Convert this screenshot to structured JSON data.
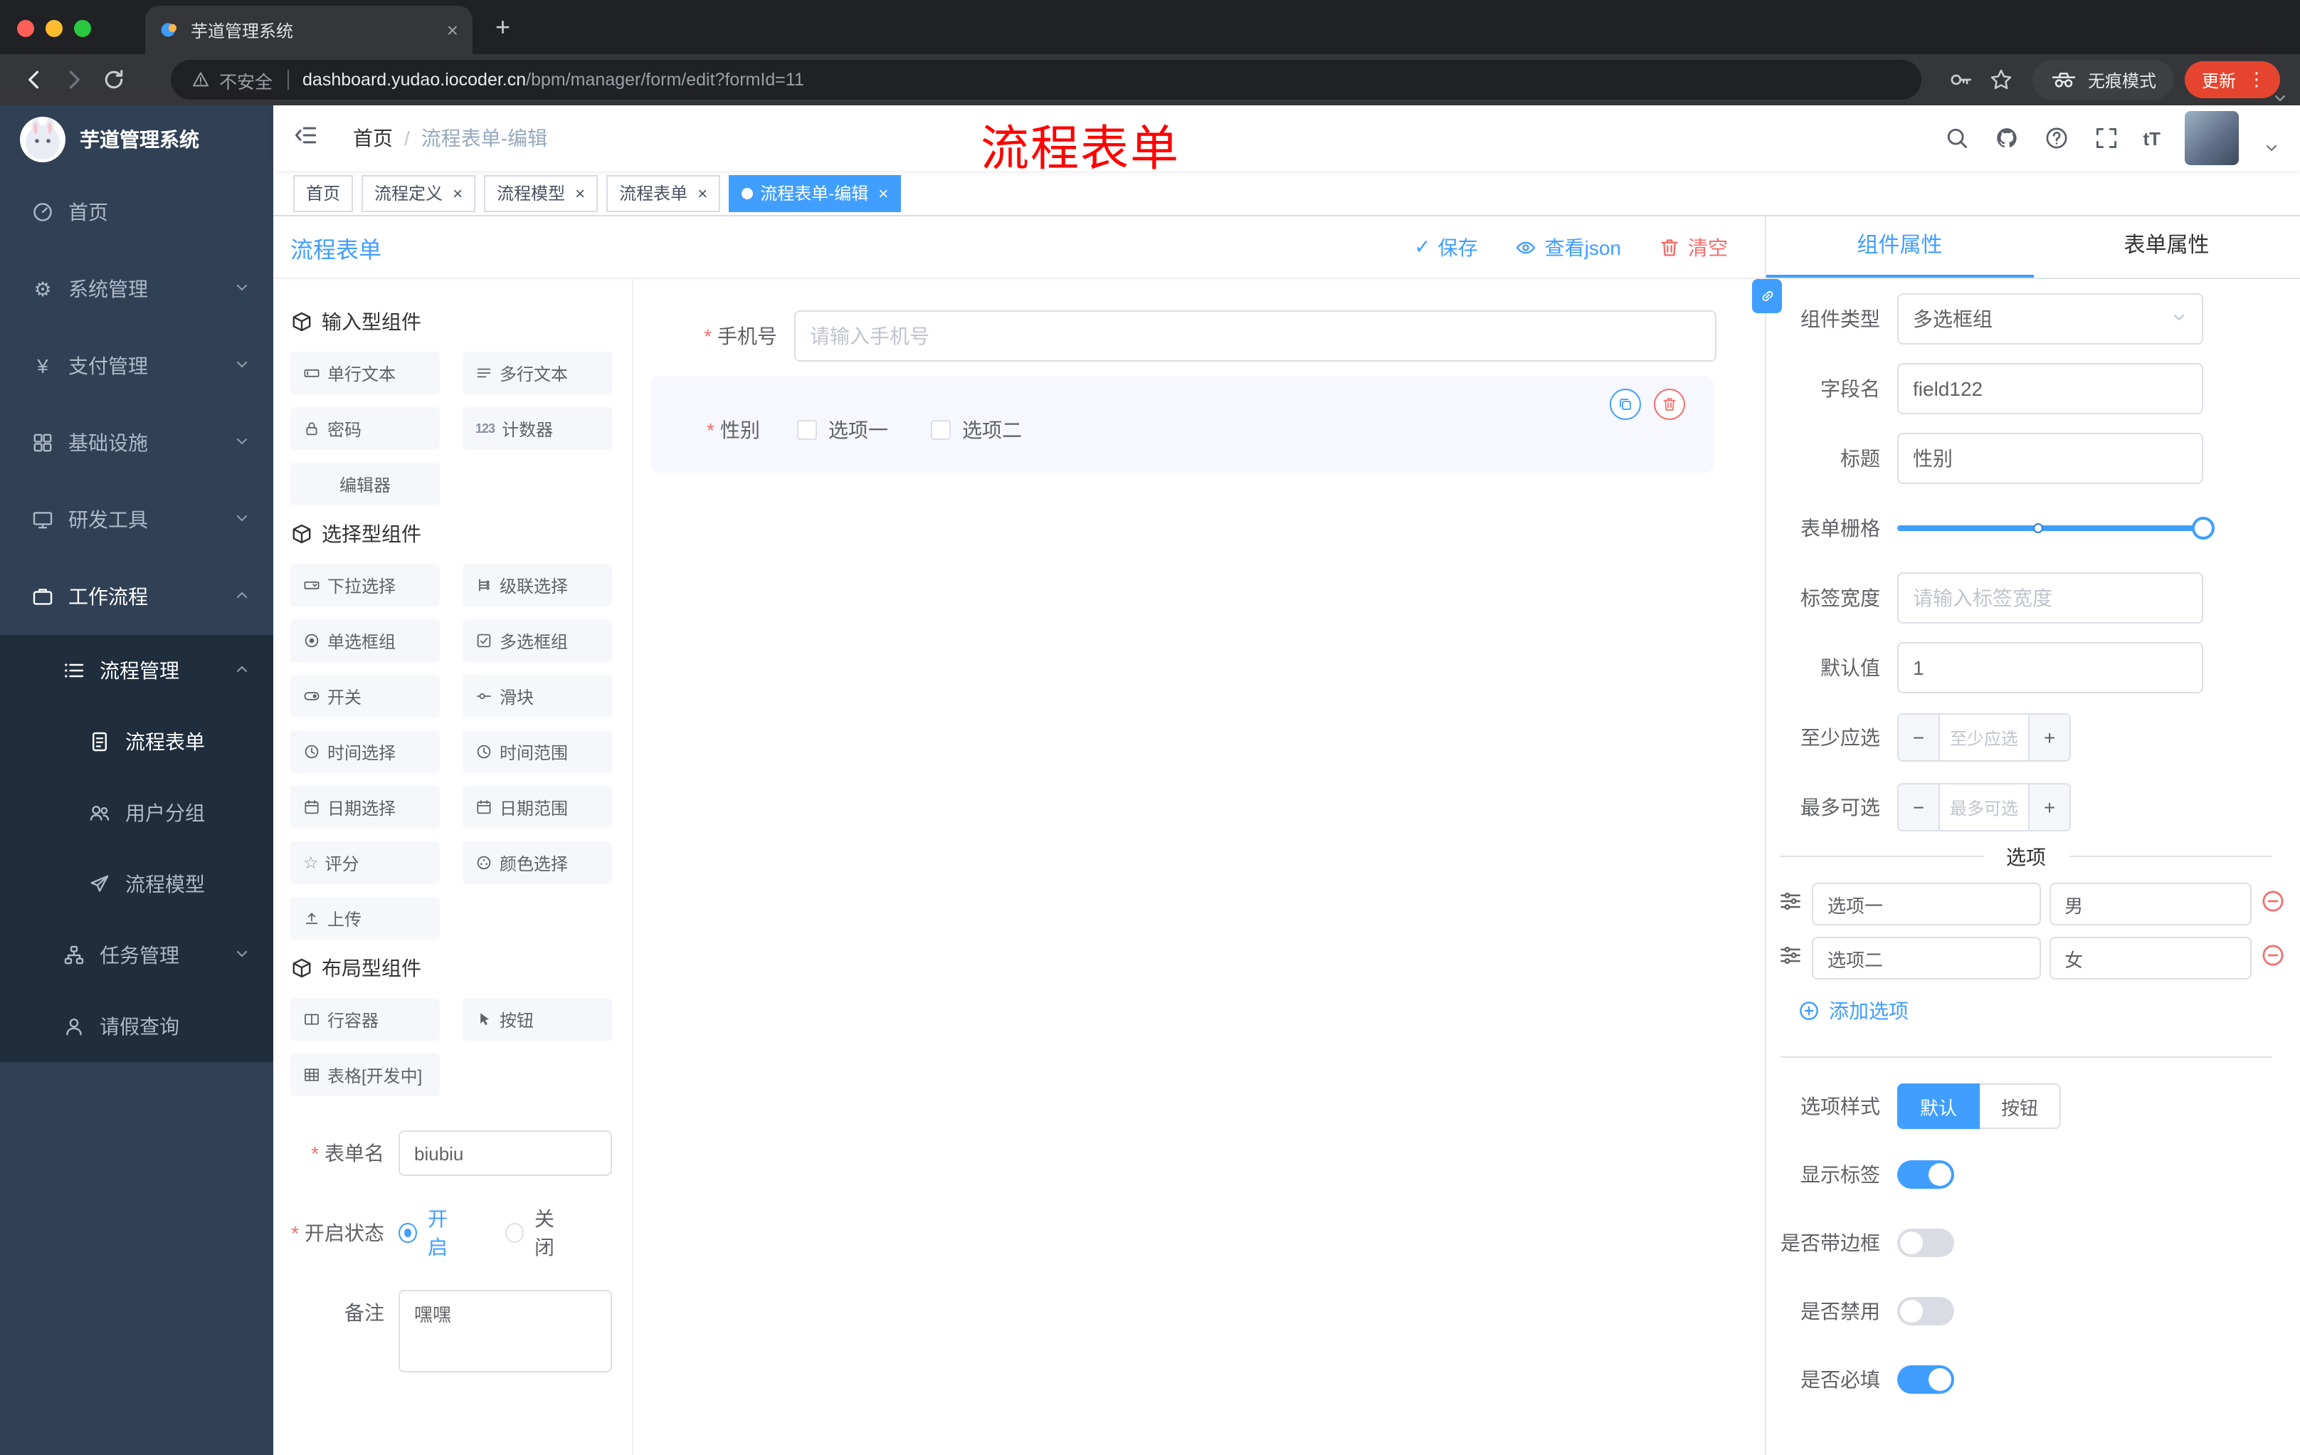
{
  "colors": {
    "primary": "#409eff",
    "danger": "#f56c6c",
    "update_chip": "#e5452f",
    "sidebar_bg": "#304156",
    "submenu_bg": "#1f2d3d",
    "annotation_red": "#fe0000"
  },
  "icons": {
    "close": "×",
    "plus": "+",
    "kebab": "⋮",
    "check": "✓",
    "gear": "⚙",
    "yen": "¥",
    "star": "☆",
    "question": "?",
    "text_size": "tT",
    "counter": "123"
  },
  "browser": {
    "tab_title": "芋道管理系统",
    "security_label": "不安全",
    "url_domain": "dashboard.yudao.iocoder.cn",
    "url_path": "/bpm/manager/form/edit?formId=11",
    "incognito_label": "无痕模式",
    "update_label": "更新"
  },
  "sidebar": {
    "logo_title": "芋道管理系统",
    "items": [
      {
        "label": "首页",
        "icon": "dashboard-icon"
      },
      {
        "label": "系统管理",
        "icon": "gear-icon",
        "chevron": "down"
      },
      {
        "label": "支付管理",
        "icon": "yen-icon",
        "chevron": "down"
      },
      {
        "label": "基础设施",
        "icon": "grid-icon",
        "chevron": "down"
      },
      {
        "label": "研发工具",
        "icon": "monitor-icon",
        "chevron": "down"
      },
      {
        "label": "工作流程",
        "icon": "briefcase-icon",
        "chevron": "up",
        "active": true
      },
      {
        "label": "流程管理",
        "icon": "list-icon",
        "chevron": "up",
        "active": true
      },
      {
        "label": "流程表单",
        "icon": "document-icon",
        "active": true
      },
      {
        "label": "用户分组",
        "icon": "users-icon"
      },
      {
        "label": "流程模型",
        "icon": "send-icon"
      },
      {
        "label": "任务管理",
        "icon": "tree-icon",
        "chevron": "down"
      },
      {
        "label": "请假查询",
        "icon": "user-icon"
      }
    ]
  },
  "header": {
    "breadcrumb": [
      "首页",
      "流程表单-编辑"
    ],
    "breadcrumb_separator": "/",
    "annotation": "流程表单"
  },
  "tags": [
    {
      "label": "首页",
      "closable": false,
      "active": false
    },
    {
      "label": "流程定义",
      "closable": true,
      "active": false
    },
    {
      "label": "流程模型",
      "closable": true,
      "active": false
    },
    {
      "label": "流程表单",
      "closable": true,
      "active": false
    },
    {
      "label": "流程表单-编辑",
      "closable": true,
      "active": true
    }
  ],
  "designer": {
    "title": "流程表单",
    "actions": {
      "save": "保存",
      "view_json": "查看json",
      "clear": "清空"
    },
    "component_sections": [
      {
        "title": "输入型组件",
        "items": [
          {
            "label": "单行文本",
            "icon": "input-icon"
          },
          {
            "label": "多行文本",
            "icon": "textarea-icon"
          },
          {
            "label": "密码",
            "icon": "lock-icon"
          },
          {
            "label": "计数器",
            "icon": "counter-icon"
          },
          {
            "label": "编辑器",
            "icon": "none"
          }
        ]
      },
      {
        "title": "选择型组件",
        "items": [
          {
            "label": "下拉选择",
            "icon": "select-icon"
          },
          {
            "label": "级联选择",
            "icon": "cascade-icon"
          },
          {
            "label": "单选框组",
            "icon": "radio-icon"
          },
          {
            "label": "多选框组",
            "icon": "checkbox-icon"
          },
          {
            "label": "开关",
            "icon": "switch-icon"
          },
          {
            "label": "滑块",
            "icon": "slider-icon"
          },
          {
            "label": "时间选择",
            "icon": "clock-icon"
          },
          {
            "label": "时间范围",
            "icon": "time-range-icon"
          },
          {
            "label": "日期选择",
            "icon": "calendar-icon"
          },
          {
            "label": "日期范围",
            "icon": "calendar-range-icon"
          },
          {
            "label": "评分",
            "icon": "star-icon"
          },
          {
            "label": "颜色选择",
            "icon": "color-icon"
          },
          {
            "label": "上传",
            "icon": "upload-icon"
          }
        ]
      },
      {
        "title": "布局型组件",
        "items": [
          {
            "label": "行容器",
            "icon": "row-icon"
          },
          {
            "label": "按钮",
            "icon": "button-icon"
          },
          {
            "label": "表格[开发中]",
            "icon": "table-icon"
          }
        ]
      }
    ],
    "form_meta": {
      "name_label": "表单名",
      "name_value": "biubiu",
      "status_label": "开启状态",
      "status_options": [
        "开启",
        "关闭"
      ],
      "status_value": "开启",
      "remark_label": "备注",
      "remark_value": "嘿嘿"
    },
    "canvas": {
      "fields": [
        {
          "label": "手机号",
          "required": true,
          "type": "input",
          "placeholder": "请输入手机号"
        },
        {
          "label": "性别",
          "required": true,
          "type": "checkbox-group",
          "selected": true,
          "options": [
            "选项一",
            "选项二"
          ]
        }
      ]
    }
  },
  "properties": {
    "tabs": [
      "组件属性",
      "表单属性"
    ],
    "active_tab": "组件属性",
    "fields": {
      "component_type_label": "组件类型",
      "component_type_value": "多选框组",
      "field_name_label": "字段名",
      "field_name_value": "field122",
      "title_label": "标题",
      "title_value": "性别",
      "grid_label": "表单栅格",
      "grid_slider": {
        "value_percent": 100,
        "stop_percent": 46
      },
      "label_width_label": "标签宽度",
      "label_width_placeholder": "请输入标签宽度",
      "default_label": "默认值",
      "default_value": "1",
      "min_label": "至少应选",
      "min_placeholder": "至少应选",
      "max_label": "最多可选",
      "max_placeholder": "最多可选"
    },
    "options_section": {
      "title": "选项",
      "options": [
        {
          "label": "选项一",
          "value": "男"
        },
        {
          "label": "选项二",
          "value": "女"
        }
      ],
      "add_label": "添加选项"
    },
    "style_section": {
      "style_label": "选项样式",
      "style_options": [
        "默认",
        "按钮"
      ],
      "style_value": "默认",
      "toggles": [
        {
          "label": "显示标签",
          "on": true
        },
        {
          "label": "是否带边框",
          "on": false
        },
        {
          "label": "是否禁用",
          "on": false
        },
        {
          "label": "是否必填",
          "on": true
        }
      ]
    }
  }
}
